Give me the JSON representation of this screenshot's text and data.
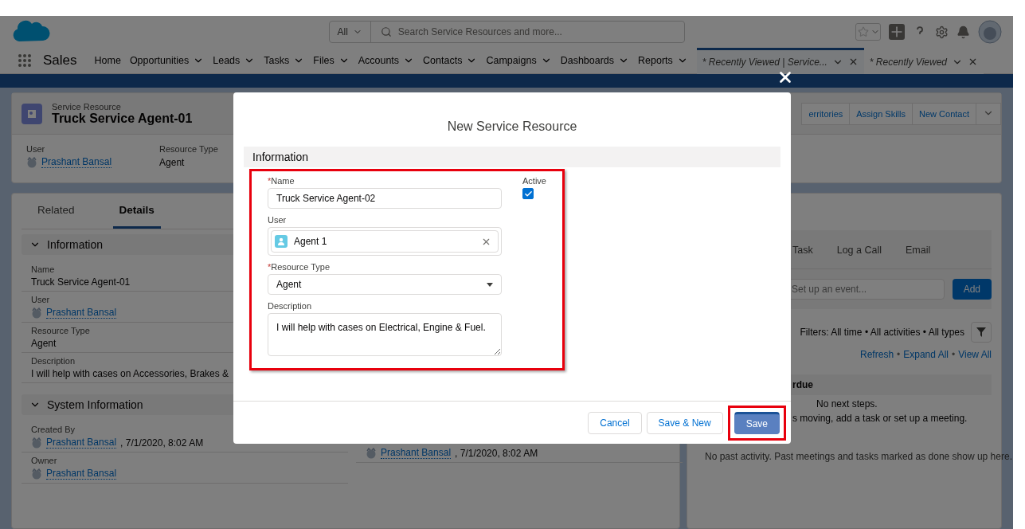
{
  "header": {
    "search": {
      "scope": "All",
      "placeholder": "Search Service Resources and more..."
    }
  },
  "nav": {
    "app_name": "Sales",
    "items": [
      {
        "label": "Home",
        "menu": false
      },
      {
        "label": "Opportunities",
        "menu": true
      },
      {
        "label": "Leads",
        "menu": true
      },
      {
        "label": "Tasks",
        "menu": true
      },
      {
        "label": "Files",
        "menu": true
      },
      {
        "label": "Accounts",
        "menu": true
      },
      {
        "label": "Contacts",
        "menu": true
      },
      {
        "label": "Campaigns",
        "menu": true
      },
      {
        "label": "Dashboards",
        "menu": true
      },
      {
        "label": "Reports",
        "menu": true
      }
    ],
    "workspace_tabs": [
      {
        "label": "* Recently Viewed | Service...",
        "selected": true
      },
      {
        "label": "* Recently Viewed",
        "selected": false
      }
    ]
  },
  "record": {
    "type": "Service Resource",
    "title": "Truck Service Agent-01",
    "actions": [
      "erritories",
      "Assign Skills",
      "New Contact"
    ],
    "highlights": [
      {
        "label": "User",
        "value": "Prashant Bansal",
        "kind": "user"
      },
      {
        "label": "Resource Type",
        "value": "Agent",
        "kind": "text"
      }
    ]
  },
  "detail_tabs": [
    {
      "label": "Related",
      "selected": false
    },
    {
      "label": "Details",
      "selected": true
    }
  ],
  "sections": [
    {
      "title": "Information",
      "expanded": true,
      "fields": [
        {
          "label": "Name",
          "value": "Truck Service Agent-01",
          "kind": "text"
        },
        {
          "label": "User",
          "value": "Prashant Bansal",
          "kind": "user"
        },
        {
          "label": "Resource Type",
          "value": "Agent",
          "kind": "text"
        },
        {
          "label": "Description",
          "value": "I will help with cases on Accessories, Brakes &",
          "kind": "text"
        }
      ]
    },
    {
      "title": "System Information",
      "expanded": true,
      "fields": [
        {
          "label": "Created By",
          "value": "Prashant Bansal",
          "suffix": ", 7/1/2020, 8:02 AM",
          "kind": "user"
        },
        {
          "label": "Owner",
          "value": "Prashant Bansal",
          "kind": "user"
        }
      ],
      "side_value": {
        "value": "Prashant Bansal",
        "suffix": ", 7/1/2020, 8:02 AM"
      }
    }
  ],
  "activity": {
    "tabs": [
      "Task",
      "Log a Call",
      "Email"
    ],
    "event_placeholder": "Set up an event...",
    "add_label": "Add",
    "filters": "Filters: All time • All activities • All types",
    "links": [
      "Refresh",
      "Expand All",
      "View All"
    ],
    "link_separator": "•",
    "upcoming_title": "rdue",
    "empty_lines": [
      "No next steps.",
      "s moving, add a task or set up a meeting."
    ],
    "past": "No past activity. Past meetings and tasks marked as done show up here."
  },
  "modal": {
    "title": "New Service Resource",
    "section": "Information",
    "form_highlighted": true,
    "fields": [
      {
        "label": "Name",
        "marker": "*",
        "kind": "text",
        "value": "Truck Service Agent-02"
      },
      {
        "label": "User",
        "kind": "lookup",
        "value": "Agent 1"
      },
      {
        "label": "Resource Type",
        "marker": "*",
        "kind": "select",
        "value": "Agent"
      },
      {
        "label": "Description",
        "kind": "textarea",
        "value": "I will help with cases on Electrical, Engine & Fuel."
      }
    ],
    "active": {
      "label": "Active",
      "checked": true
    },
    "buttons": [
      {
        "label": "Cancel",
        "kind": "neutral",
        "highlighted": false
      },
      {
        "label": "Save & New",
        "kind": "neutral",
        "highlighted": false
      },
      {
        "label": "Save",
        "kind": "brand",
        "highlighted": true
      }
    ]
  }
}
